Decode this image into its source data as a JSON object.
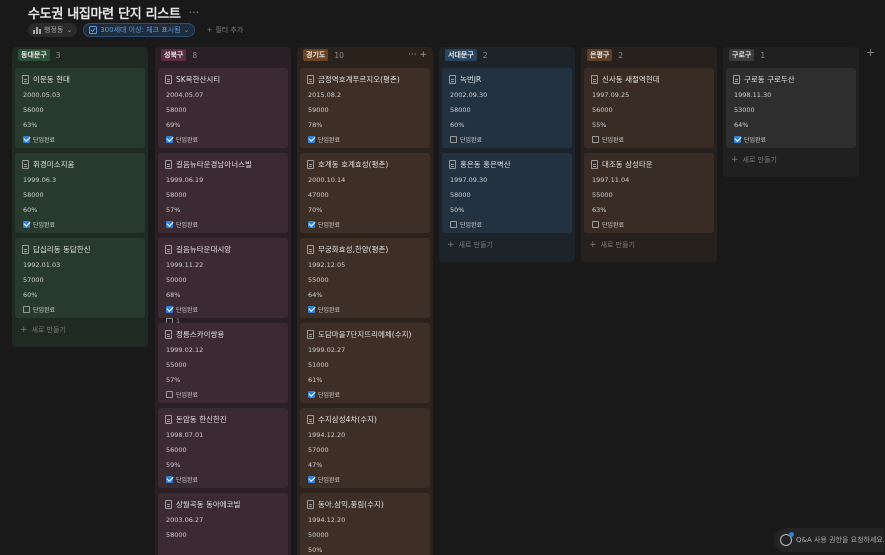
{
  "page": {
    "title": "수도권 내집마련 단지 리스트",
    "more": "···",
    "board_add": "+"
  },
  "toolbar": {
    "group_label": "행정동",
    "filter_label": "300세대 이상: 체크 표시됨",
    "add_filter_label": "필터 추가"
  },
  "columns": [
    {
      "name": "동대문구",
      "count": "3",
      "tag_color": "#2b5035",
      "bg": "#1f2a22",
      "card_bg": "#283a2d",
      "cards": [
        {
          "title": "이문동 현대",
          "date": "2000.05.03",
          "price": "56000",
          "ratio": "63%",
          "checked": true,
          "check_label": "단임완료"
        },
        {
          "title": "휘경미소지움",
          "date": "1999.06.3",
          "price": "58000",
          "ratio": "60%",
          "checked": true,
          "check_label": "단임완료"
        },
        {
          "title": "답십리동 동답한신",
          "date": "1992.01.03",
          "price": "57000",
          "ratio": "60%",
          "checked": false,
          "check_label": "단임완료"
        }
      ],
      "new_label": "새로 만들기"
    },
    {
      "name": "성북구",
      "count": "8",
      "tag_color": "#5a2e3e",
      "bg": "#2a1f24",
      "card_bg": "#3b2a32",
      "cards": [
        {
          "title": "SK북한산시티",
          "date": "2004.05.07",
          "price": "58000",
          "ratio": "69%",
          "checked": true,
          "check_label": "단임완료"
        },
        {
          "title": "길음뉴타운경남아너스빌",
          "date": "1999.06.19",
          "price": "58000",
          "ratio": "57%",
          "checked": true,
          "check_label": "단임완료"
        },
        {
          "title": "길음뉴타운대시앙",
          "date": "1999.11.22",
          "price": "50000",
          "ratio": "68%",
          "checked": true,
          "check_label": "단임완료",
          "comments": "1"
        },
        {
          "title": "정릉스카이쌍용",
          "date": "1999.02.12",
          "price": "55000",
          "ratio": "57%",
          "checked": false,
          "check_label": "단임완료"
        },
        {
          "title": "돈암동 한신한진",
          "date": "1998.07.01",
          "price": "56000",
          "ratio": "59%",
          "checked": true,
          "check_label": "단임완료"
        },
        {
          "title": "상월곡동 동아에코빌",
          "date": "2003.06.27",
          "price": "58000",
          "ratio": "",
          "checked": false,
          "check_label": ""
        }
      ]
    },
    {
      "name": "경기도",
      "count": "10",
      "tag_color": "#6b4325",
      "bg": "#2b221c",
      "card_bg": "#3d2f26",
      "actions": "··· +",
      "cards": [
        {
          "title": "금정역호계푸르지오(평촌)",
          "date": "2015.08.2",
          "price": "59000",
          "ratio": "78%",
          "checked": true,
          "check_label": "단임완료"
        },
        {
          "title": "호계동 호계효성(평촌)",
          "date": "2000.10.14",
          "price": "47000",
          "ratio": "70%",
          "checked": true,
          "check_label": "단임완료"
        },
        {
          "title": "무궁화효성,한양(평촌)",
          "date": "1992.12.05",
          "price": "55000",
          "ratio": "64%",
          "checked": true,
          "check_label": "단임완료"
        },
        {
          "title": "도담마을7단지뜨리에체(수지)",
          "date": "1999.02.27",
          "price": "51000",
          "ratio": "61%",
          "checked": true,
          "check_label": "단임완료"
        },
        {
          "title": "수지삼성4차(수지)",
          "date": "1994.12.20",
          "price": "57000",
          "ratio": "47%",
          "checked": true,
          "check_label": "단임완료"
        },
        {
          "title": "동아,삼익,풍림(수지)",
          "date": "1994.12.20",
          "price": "50000",
          "ratio": "50%",
          "checked": false,
          "check_label": ""
        }
      ]
    },
    {
      "name": "서대문구",
      "count": "2",
      "tag_color": "#27455f",
      "bg": "#1c2329",
      "card_bg": "#233240",
      "cards": [
        {
          "title": "녹번JR",
          "date": "2002.09.30",
          "price": "58000",
          "ratio": "60%",
          "checked": false,
          "check_label": "단임완료"
        },
        {
          "title": "홍은동 홍은벽산",
          "date": "1997.09.30",
          "price": "58000",
          "ratio": "50%",
          "checked": false,
          "check_label": "단임완료"
        }
      ],
      "new_label": "새로 만들기"
    },
    {
      "name": "은평구",
      "count": "2",
      "tag_color": "#5e3f28",
      "bg": "#26211d",
      "card_bg": "#382c24",
      "cards": [
        {
          "title": "신사동 새절역현대",
          "date": "1997.09.25",
          "price": "56000",
          "ratio": "55%",
          "checked": false,
          "check_label": "단임완료"
        },
        {
          "title": "대조동 삼성타운",
          "date": "1997.11.04",
          "price": "55000",
          "ratio": "63%",
          "checked": false,
          "check_label": "단임완료"
        }
      ],
      "new_label": "새로 만들기"
    },
    {
      "name": "구로구",
      "count": "1",
      "tag_color": "#3c3c3c",
      "bg": "#202020",
      "card_bg": "#2e2e2e",
      "cards": [
        {
          "title": "구로동 구로두산",
          "date": "1998.11.30",
          "price": "53000",
          "ratio": "64%",
          "checked": true,
          "check_label": "단임완료"
        }
      ],
      "new_label": "새로 만들기"
    }
  ],
  "qa": {
    "label": "Q&A 사용 권한을 요청하세요."
  }
}
